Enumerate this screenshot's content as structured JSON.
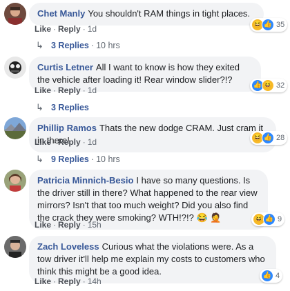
{
  "labels": {
    "like": "Like",
    "reply": "Reply",
    "dot": "·"
  },
  "comments": [
    {
      "author": "Chet Manly",
      "text": "You shouldn't RAM things in tight places.",
      "time": "1d",
      "reactions": {
        "icons": [
          "haha-icon",
          "like-icon"
        ],
        "count": "35"
      },
      "replies": {
        "label": "3 Replies",
        "time": "10 hrs"
      }
    },
    {
      "author": "Curtis Letner",
      "text": "All I want to know is how they exited the vehicle after loading it! Rear window slider?!?",
      "time": "1d",
      "reactions": {
        "icons": [
          "like-icon",
          "haha-icon"
        ],
        "count": "32"
      },
      "replies": {
        "label": "3 Replies",
        "time": ""
      }
    },
    {
      "author": "Phillip Ramos",
      "text": "Thats the new dodge CRAM. Just cram it in there!",
      "time": "1d",
      "reactions": {
        "icons": [
          "haha-icon",
          "like-icon"
        ],
        "count": "28"
      },
      "replies": {
        "label": "9 Replies",
        "time": "10 hrs"
      }
    },
    {
      "author": "Patricia Minnich-Besio",
      "text": "I have so many questions. Is the driver still in there? What happened to the rear view mirrors? Isn't that too much weight? Did you also find the crack they were smoking? WTH!?!?",
      "emoji": "😂 🤦",
      "time": "15h",
      "reactions": {
        "icons": [
          "haha-icon",
          "like-icon"
        ],
        "count": "9"
      }
    },
    {
      "author": "Zach Loveless",
      "text": "Curious what the violations were. As a tow driver it'll help me explain my costs to customers who think this might be a good idea.",
      "time": "14h",
      "reactions": {
        "icons": [
          "like-icon"
        ],
        "count": "4"
      }
    }
  ],
  "colors": {
    "author": "#385898",
    "bubble": "#f2f3f5",
    "like": "#2d88ff",
    "haha": "#f7b928"
  }
}
